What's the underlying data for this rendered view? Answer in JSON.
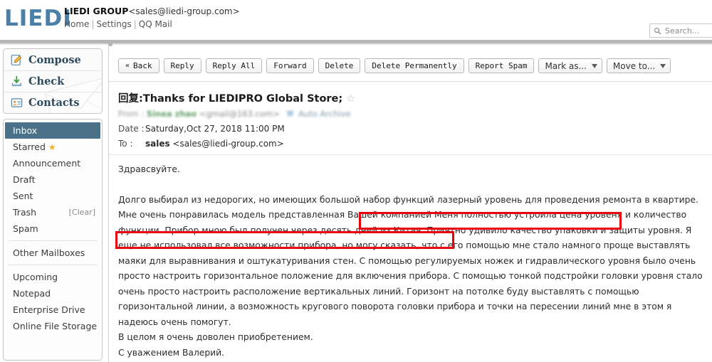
{
  "header": {
    "logo": "LIEDI",
    "brand_name": "LIEDI GROUP",
    "brand_email": "<sales@liedi-group.com>",
    "nav": [
      {
        "label": "Home"
      },
      {
        "label": "Settings"
      },
      {
        "label": "QQ Mail"
      }
    ],
    "search_placeholder": "Search...",
    "search_value": "",
    "search_icon": "search-icon"
  },
  "sidebar": {
    "quick_actions": [
      {
        "label": "Compose",
        "icon": "compose-pencil-icon"
      },
      {
        "label": "Check",
        "icon": "download-inbox-icon"
      },
      {
        "label": "Contacts",
        "icon": "contacts-card-icon"
      }
    ],
    "folders": [
      {
        "label": "Inbox",
        "active": true,
        "badge": ""
      },
      {
        "label": "Starred",
        "active": false,
        "badge": "",
        "star": "★"
      },
      {
        "label": "Announcement",
        "active": false,
        "badge": ""
      },
      {
        "label": "Draft",
        "active": false,
        "badge": ""
      },
      {
        "label": "Sent",
        "active": false,
        "badge": ""
      },
      {
        "label": "Trash",
        "active": false,
        "badge": "[Clear]"
      },
      {
        "label": "Spam",
        "active": false,
        "badge": ""
      }
    ],
    "other_mailboxes_label": "Other Mailboxes",
    "apps": [
      {
        "label": "Upcoming"
      },
      {
        "label": "Notepad"
      },
      {
        "label": "Enterprise Drive"
      },
      {
        "label": "Online File Storage"
      }
    ]
  },
  "toolbar": {
    "back_label": "Back",
    "back_chevron": "«",
    "buttons": [
      {
        "label": "Reply"
      },
      {
        "label": "Reply All"
      },
      {
        "label": "Forward"
      },
      {
        "label": "Delete"
      },
      {
        "label": "Delete Permanently"
      },
      {
        "label": "Report Spam"
      }
    ],
    "selects": [
      {
        "label": "Mark as...",
        "icon": "chevron-down-icon"
      },
      {
        "label": "Move to...",
        "icon": "chevron-down-icon"
      }
    ]
  },
  "mail": {
    "subject": "回复:Thanks for LIEDIPRO Global Store;",
    "subject_star": "☆",
    "from_label": "From :",
    "from_name": "Sinea zhao",
    "from_address": "<gmail@163.com>",
    "auto_archive_label": "Auto Archive",
    "auto_archive_icon": "archive-box-icon",
    "date_label": "Date :",
    "date_value": "Saturday,Oct 27, 2018 11:00 PM",
    "to_label": "To :",
    "to_name": "sales",
    "to_address": "<sales@liedi-group.com>",
    "body": {
      "greeting": "Здравсвуйте.",
      "paragraph": "Долго выбирал из недорогих, но имеющих большой набор функций лазерный уровень для проведения ремонта в квартире. Мне очень понравилась модель представленная Вашей компанией Меня полностью устроила цена уровеня и количество функции. Прибор мною был получен через десять дней из Китая. Приятно удивило качество упаковки и защиты уровня. Я еще не использовал все возможности прибора, но могу сказать, что с его помощью мне стало намного проще выставлять маяки для выравнивания и оштукатуривания стен. С помощью регулируемых ножек и гидравлического уровня было очень просто настроить горизонтальное положение для включения прибора. С помощью тонкой подстройки головки уровня стало очень просто настроить расположение вертикальных линий. Горизонт на потолке буду выставлять с помощью горизонтальной линии, а возможность кругового поворота головки прибора и точки на пересении линий мне в этом я надеюсь очень помогут.",
      "closing_1": "В целом я очень доволен приобретением.",
      "closing_2": "С уважением Валерий."
    }
  },
  "annotations": {
    "color": "#e8000d",
    "boxes": [
      {
        "name": "highlight-box-1",
        "text": "Меня полностью устроила цена уровеня и количество функции."
      },
      {
        "name": "highlight-box-2",
        "text": "получен через десять дней из Китая. Приятно удивило качество упаковки и защиты уровня."
      }
    ]
  },
  "colors": {
    "logo_blue": "#4a7fa8",
    "active_folder": "#4b7188",
    "annotation_red": "#e8000d",
    "quick_text": "#2e4a5c"
  }
}
